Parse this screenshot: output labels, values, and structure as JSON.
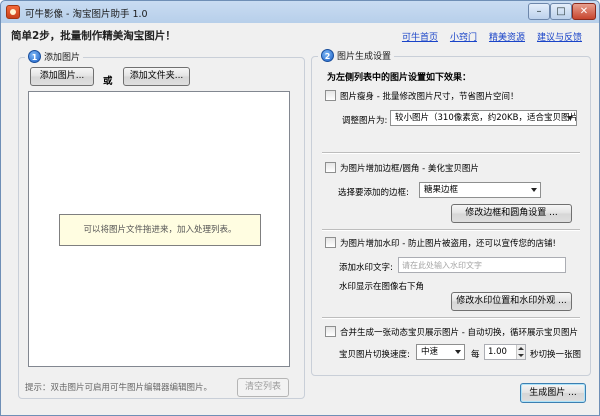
{
  "window": {
    "title": "可牛影像 - 淘宝图片助手 1.0",
    "controls": {
      "minimize": "–",
      "maximize": "□",
      "close": "✕"
    }
  },
  "header": {
    "title": "简单2步，批量制作精美淘宝图片！",
    "links": [
      "可牛首页",
      "小窍门",
      "精美资源",
      "建议与反馈"
    ]
  },
  "left_panel": {
    "step": "1",
    "title": "添加图片",
    "add_image_button": "添加图片...",
    "or_label": "或",
    "add_folder_button": "添加文件夹...",
    "drop_hint": "可以将图片文件拖进来，加入处理列表。",
    "tip": "提示：双击图片可启用可牛图片编辑器编辑图片。",
    "clear_button": "清空列表"
  },
  "right_panel": {
    "step": "2",
    "title": "图片生成设置",
    "heading": "为左侧列表中的图片设置如下效果：",
    "resize": {
      "checkbox_label": "图片瘦身 - 批量修改图片尺寸，节省图片空间！",
      "field_label": "调整图片为:",
      "selected_option": "较小图片（310像素宽，约20KB，适合宝贝图片）"
    },
    "border": {
      "checkbox_label": "为图片增加边框/圆角 - 美化宝贝图片",
      "field_label": "选择要添加的边框:",
      "selected_option": "糖果边框",
      "settings_button": "修改边框和圆角设置 ..."
    },
    "watermark": {
      "checkbox_label": "为图片增加水印 - 防止图片被盗用，还可以宣传您的店铺!",
      "field_label": "添加水印文字:",
      "placeholder": "请在此处输入水印文字",
      "position_text": "水印显示在图像右下角",
      "settings_button": "修改水印位置和水印外观 ..."
    },
    "slideshow": {
      "checkbox_label": "合并生成一张动态宝贝展示图片 - 自动切换，循环展示宝贝图片",
      "speed_label": "宝贝图片切换速度:",
      "speed_option": "中速",
      "every_label": "每",
      "interval_value": "1.00",
      "unit_label": "秒切换一张图"
    }
  },
  "footer": {
    "generate_button": "生成图片 ..."
  }
}
